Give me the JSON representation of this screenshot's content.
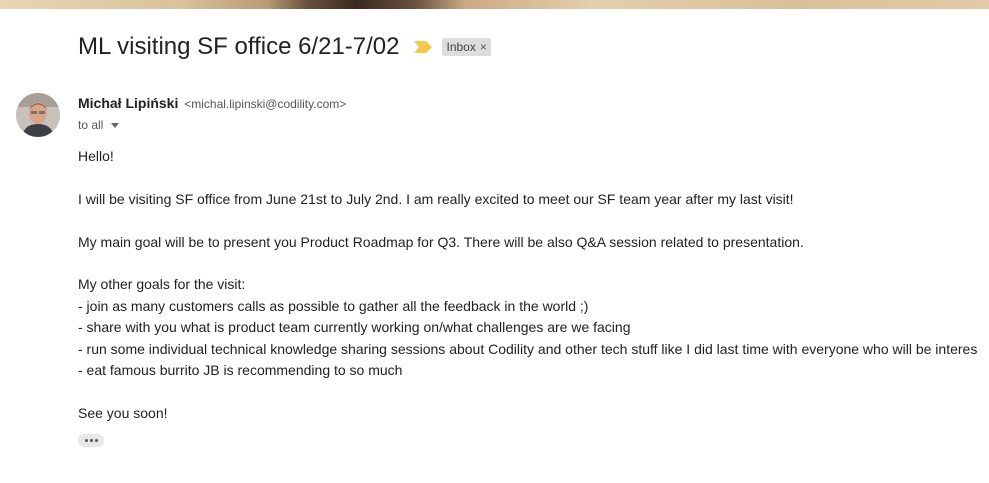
{
  "subject": "ML visiting SF office 6/21-7/02",
  "importance_marker": "importance-marker-icon",
  "label": {
    "text": "Inbox",
    "remove": "×"
  },
  "sender": {
    "name": "Michał Lipiński",
    "email": "<michal.lipinski@codility.com>",
    "recipients": "to all"
  },
  "body_lines": [
    "Hello!",
    "",
    "I will be visiting SF office from June 21st to July 2nd. I am really excited to meet our SF team year after my last visit!",
    "",
    "My main goal will be to present you Product Roadmap for Q3. There will be also Q&A session related to presentation.",
    "",
    "My other goals for the visit:",
    "- join as many customers calls as possible to gather all the feedback in the world ;)",
    "- share with you what is product team currently working on/what challenges are we facing",
    "- run some individual technical knowledge sharing sessions about Codility and other tech stuff like I did last time with everyone who will be interes",
    "- eat famous burrito JB is recommending to so much",
    "",
    "See you soon!"
  ],
  "colors": {
    "accent_marker": "#f2c94c",
    "label_bg": "#dddddd"
  }
}
